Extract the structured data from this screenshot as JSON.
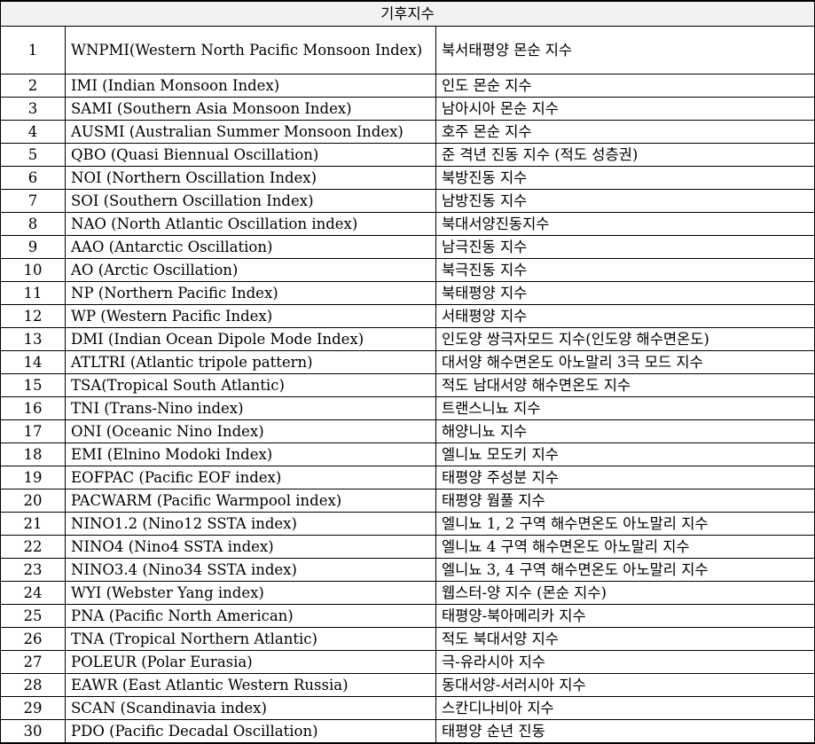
{
  "title": "기후지수",
  "rows": [
    {
      "no": "1",
      "name": "WNPMI(Western North Pacific Monsoon Index)",
      "korean": "북서태평양 몬순 지수"
    },
    {
      "no": "2",
      "name": "IMI (Indian Monsoon Index)",
      "korean": "인도 몬순 지수"
    },
    {
      "no": "3",
      "name": "SAMI (Southern Asia Monsoon Index)",
      "korean": "남아시아 몬순 지수"
    },
    {
      "no": "4",
      "name": "AUSMI (Australian Summer Monsoon Index)",
      "korean": "호주 몬순 지수"
    },
    {
      "no": "5",
      "name": "QBO (Quasi Biennual Oscillation)",
      "korean": "준 격년 진동 지수 (적도 성층권)"
    },
    {
      "no": "6",
      "name": "NOI (Northern Oscillation Index)",
      "korean": "북방진동 지수"
    },
    {
      "no": "7",
      "name": "SOI (Southern Oscillation Index)",
      "korean": "남방진동 지수"
    },
    {
      "no": "8",
      "name": "NAO (North Atlantic Oscillation index)",
      "korean": "북대서양진동지수"
    },
    {
      "no": "9",
      "name": "AAO (Antarctic Oscillation)",
      "korean": "남극진동 지수"
    },
    {
      "no": "10",
      "name": "AO (Arctic Oscillation)",
      "korean": "북극진동 지수"
    },
    {
      "no": "11",
      "name": "NP (Northern Pacific Index)",
      "korean": "북태평양 지수"
    },
    {
      "no": "12",
      "name": "WP (Western Pacific Index)",
      "korean": "서태평양 지수"
    },
    {
      "no": "13",
      "name": "DMI (Indian Ocean Dipole Mode Index)",
      "korean": "인도양 쌍극자모드 지수(인도양 해수면온도)"
    },
    {
      "no": "14",
      "name": "ATLTRI (Atlantic tripole pattern)",
      "korean": "대서양 해수면온도 아노말리 3극 모드 지수"
    },
    {
      "no": "15",
      "name": "TSA(Tropical South Atlantic)",
      "korean": "적도 남대서양 해수면온도 지수"
    },
    {
      "no": "16",
      "name": "TNI (Trans-Nino index)",
      "korean": "트랜스니뇨 지수"
    },
    {
      "no": "17",
      "name": "ONI (Oceanic Nino Index)",
      "korean": "해양니뇨 지수"
    },
    {
      "no": "18",
      "name": "EMI (Elnino Modoki Index)",
      "korean": "엘니뇨 모도키 지수"
    },
    {
      "no": "19",
      "name": "EOFPAC (Pacific EOF index)",
      "korean": "태평양 주성분 지수"
    },
    {
      "no": "20",
      "name": "PACWARM (Pacific Warmpool index)",
      "korean": "태평양 웜풀 지수"
    },
    {
      "no": "21",
      "name": "NINO1.2 (Nino12 SSTA index)",
      "korean": "엘니뇨 1, 2 구역 해수면온도 아노말리 지수"
    },
    {
      "no": "22",
      "name": "NINO4 (Nino4 SSTA index)",
      "korean": "엘니뇨 4 구역 해수면온도 아노말리 지수"
    },
    {
      "no": "23",
      "name": "NINO3.4 (Nino34 SSTA index)",
      "korean": "엘니뇨 3, 4 구역 해수면온도 아노말리 지수"
    },
    {
      "no": "24",
      "name": "WYI (Webster Yang index)",
      "korean": "웹스터-양 지수 (몬순 지수)"
    },
    {
      "no": "25",
      "name": "PNA (Pacific North American)",
      "korean": "태평양-북아메리카 지수"
    },
    {
      "no": "26",
      "name": "TNA (Tropical Northern Atlantic)",
      "korean": "적도 북대서양 지수"
    },
    {
      "no": "27",
      "name": "POLEUR (Polar Eurasia)",
      "korean": "극-유라시아 지수"
    },
    {
      "no": "28",
      "name": "EAWR (East Atlantic Western Russia)",
      "korean": "동대서양-서러시아 지수"
    },
    {
      "no": "29",
      "name": "SCAN (Scandinavia index)",
      "korean": "스칸디나비아 지수"
    },
    {
      "no": "30",
      "name": "PDO (Pacific Decadal Oscillation)",
      "korean": "태평양 순년 진동"
    }
  ]
}
